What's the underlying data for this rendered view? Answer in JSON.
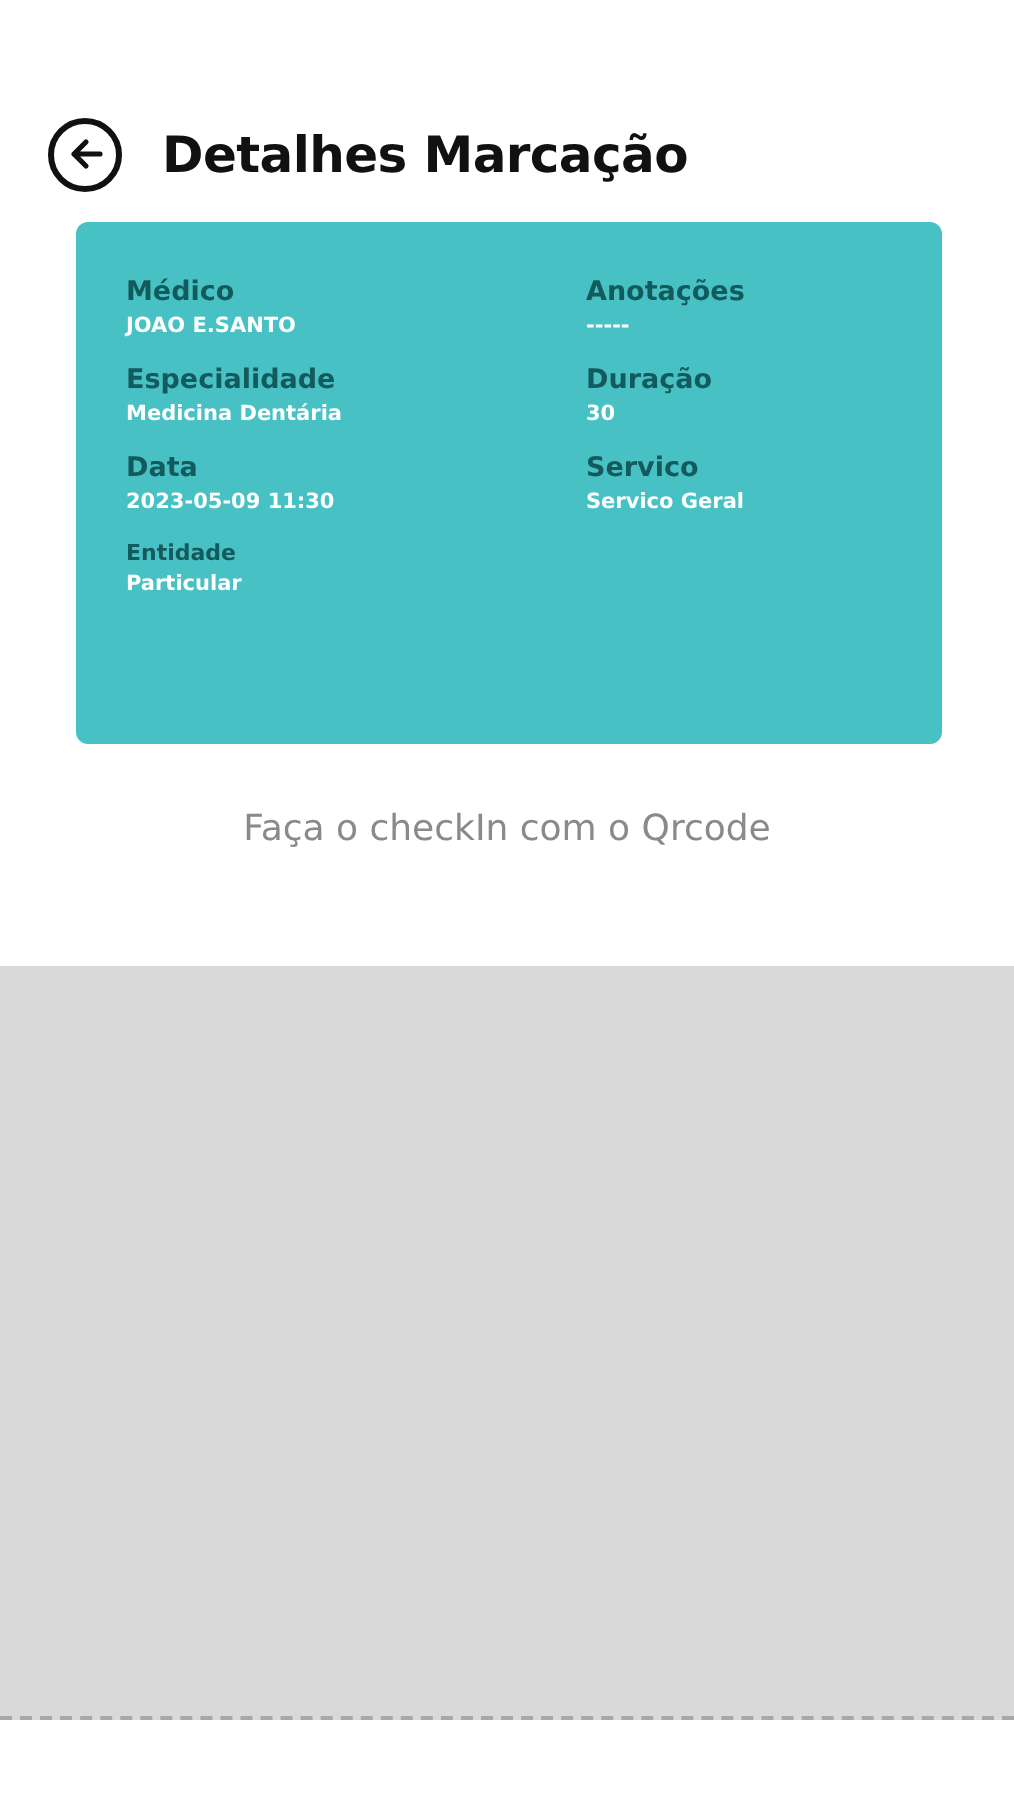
{
  "header": {
    "title": "Detalhes Marcação"
  },
  "details": [
    {
      "kind": "main",
      "label": "Médico",
      "value": "JOAO E.SANTO"
    },
    {
      "kind": "main",
      "label": "Anotações",
      "value": "-----"
    },
    {
      "kind": "main",
      "label": "Especialidade",
      "value": "Medicina Dentária"
    },
    {
      "kind": "main",
      "label": "Duração",
      "value": "30"
    },
    {
      "kind": "main",
      "label": "Data",
      "value": "2023-05-09 11:30"
    },
    {
      "kind": "main",
      "label": "Servico",
      "value": "Servico Geral"
    },
    {
      "kind": "minor",
      "label": "Entidade",
      "value": "Particular"
    }
  ],
  "instruction": "Faça o checkIn com o Qrcode"
}
